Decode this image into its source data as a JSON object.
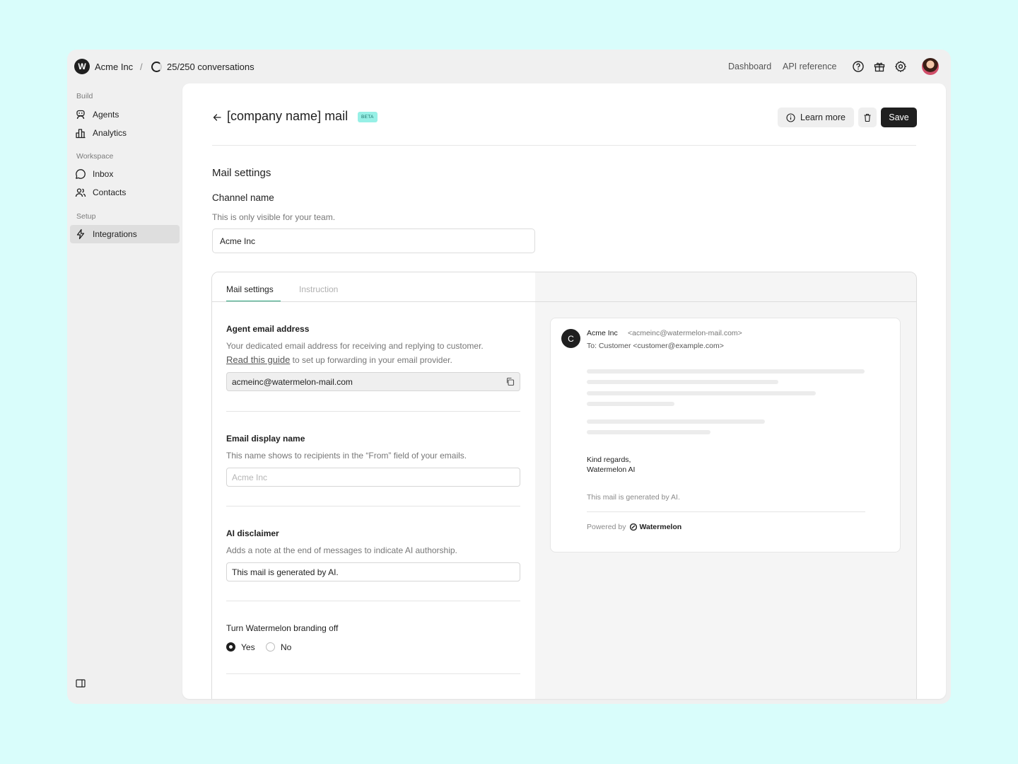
{
  "topbar": {
    "logo_letter": "W",
    "org": "Acme Inc",
    "sep": "/",
    "conversations": "25/250 conversations",
    "nav": {
      "dashboard": "Dashboard",
      "api": "API reference"
    },
    "icons": [
      "help-icon",
      "gift-icon",
      "settings-icon"
    ]
  },
  "sidebar": {
    "sections": [
      {
        "title": "Build",
        "items": [
          {
            "label": "Agents",
            "icon": "agent-icon"
          },
          {
            "label": "Analytics",
            "icon": "chart-icon"
          }
        ]
      },
      {
        "title": "Workspace",
        "items": [
          {
            "label": "Inbox",
            "icon": "chat-bubble-icon"
          },
          {
            "label": "Contacts",
            "icon": "users-icon"
          }
        ]
      },
      {
        "title": "Setup",
        "items": [
          {
            "label": "Integrations",
            "icon": "bolt-icon",
            "active": true
          }
        ]
      }
    ]
  },
  "page": {
    "title": "[company name] mail",
    "badge": "BETA",
    "learn_more": "Learn more",
    "save": "Save",
    "section_title": "Mail settings",
    "channel": {
      "label": "Channel name",
      "help": "This is only visible for your team.",
      "value": "Acme Inc"
    }
  },
  "tabs": {
    "mail_settings": "Mail settings",
    "instruction": "Instruction"
  },
  "form": {
    "agent_email": {
      "label": "Agent email address",
      "desc1": "Your dedicated email address for receiving and replying to customer.",
      "guide_link": "Read this guide",
      "desc2": " to set up forwarding in your email provider.",
      "value": "acmeinc@watermelon-mail.com"
    },
    "display_name": {
      "label": "Email display name",
      "desc": "This name shows to recipients in the “From” field of your emails.",
      "placeholder": "Acme Inc"
    },
    "disclaimer": {
      "label": "AI disclaimer",
      "desc": "Adds a note at the end of messages to indicate AI authorship.",
      "value": "This mail is generated by AI."
    },
    "branding": {
      "label": "Turn Watermelon branding off",
      "yes": "Yes",
      "no": "No",
      "selected": "Yes"
    }
  },
  "preview": {
    "avatar_letter": "C",
    "from_name": "Acme Inc",
    "from_address": "<acmeinc@watermelon-mail.com>",
    "to": "To: Customer <customer@example.com>",
    "regards_line1": "Kind regards,",
    "regards_line2": "Watermelon AI",
    "ai_note": "This mail is generated by AI.",
    "powered_by": "Powered by",
    "brand": "Watermelon"
  },
  "colors": {
    "accent": "#27a37b",
    "beta_bg": "#97f0e6",
    "primary_button": "#1f1f1f",
    "background": "#d9fdfb"
  }
}
